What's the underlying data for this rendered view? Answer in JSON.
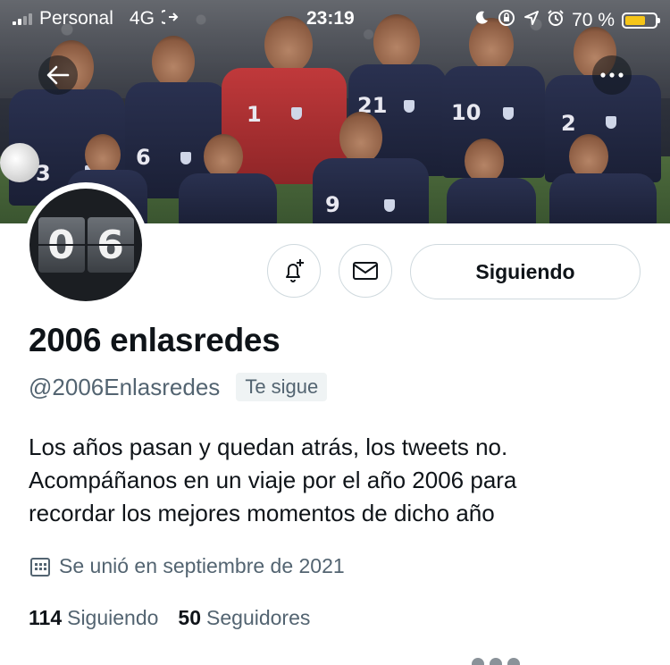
{
  "status_bar": {
    "carrier": "Personal",
    "network": "4G",
    "time": "23:19",
    "battery_percent": "70 %",
    "battery_level": 0.7,
    "battery_color": "#f5c518"
  },
  "banner": {
    "description_icons": [
      "back-arrow-icon",
      "more-dots-icon"
    ],
    "shirt_numbers": [
      "3",
      "6",
      "1",
      "21",
      "10",
      "2",
      "9"
    ]
  },
  "avatar": {
    "digits": [
      "0",
      "6"
    ]
  },
  "actions": {
    "notify_icon": "bell-plus-icon",
    "message_icon": "envelope-icon",
    "follow_label": "Siguiendo"
  },
  "profile": {
    "name": "2006 enlasredes",
    "handle": "@2006Enlasredes",
    "follows_you": "Te sigue",
    "bio_lines": [
      "Los años pasan y quedan atrás, los tweets no.",
      "Acompáñanos en un viaje por el año 2006 para",
      "recordar los mejores momentos de dicho año"
    ],
    "joined": "Se unió en septiembre de 2021",
    "following_count": "114",
    "following_label": "Siguiendo",
    "followers_count": "50",
    "followers_label": "Seguidores"
  },
  "colors": {
    "text_primary": "#0f1419",
    "text_secondary": "#536471",
    "border": "#cfd9de",
    "badge_bg": "#eff3f4"
  }
}
